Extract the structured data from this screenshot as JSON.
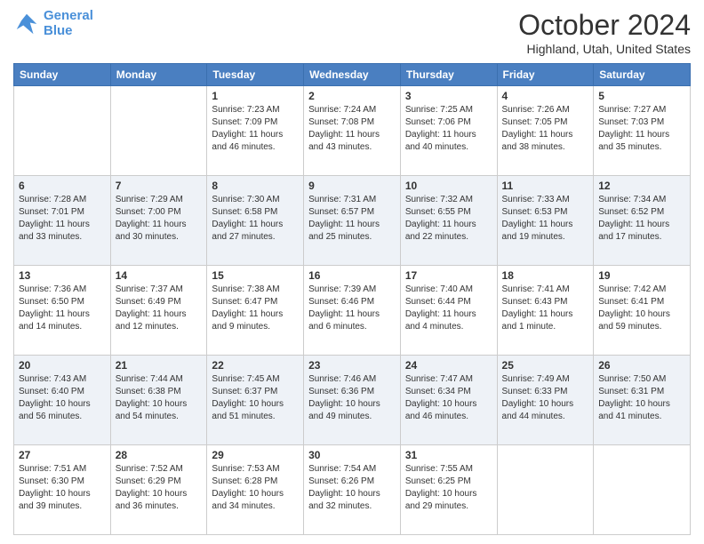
{
  "logo": {
    "line1": "General",
    "line2": "Blue"
  },
  "title": "October 2024",
  "location": "Highland, Utah, United States",
  "days_of_week": [
    "Sunday",
    "Monday",
    "Tuesday",
    "Wednesday",
    "Thursday",
    "Friday",
    "Saturday"
  ],
  "weeks": [
    [
      {
        "day": "",
        "sunrise": "",
        "sunset": "",
        "daylight": ""
      },
      {
        "day": "",
        "sunrise": "",
        "sunset": "",
        "daylight": ""
      },
      {
        "day": "1",
        "sunrise": "Sunrise: 7:23 AM",
        "sunset": "Sunset: 7:09 PM",
        "daylight": "Daylight: 11 hours and 46 minutes."
      },
      {
        "day": "2",
        "sunrise": "Sunrise: 7:24 AM",
        "sunset": "Sunset: 7:08 PM",
        "daylight": "Daylight: 11 hours and 43 minutes."
      },
      {
        "day": "3",
        "sunrise": "Sunrise: 7:25 AM",
        "sunset": "Sunset: 7:06 PM",
        "daylight": "Daylight: 11 hours and 40 minutes."
      },
      {
        "day": "4",
        "sunrise": "Sunrise: 7:26 AM",
        "sunset": "Sunset: 7:05 PM",
        "daylight": "Daylight: 11 hours and 38 minutes."
      },
      {
        "day": "5",
        "sunrise": "Sunrise: 7:27 AM",
        "sunset": "Sunset: 7:03 PM",
        "daylight": "Daylight: 11 hours and 35 minutes."
      }
    ],
    [
      {
        "day": "6",
        "sunrise": "Sunrise: 7:28 AM",
        "sunset": "Sunset: 7:01 PM",
        "daylight": "Daylight: 11 hours and 33 minutes."
      },
      {
        "day": "7",
        "sunrise": "Sunrise: 7:29 AM",
        "sunset": "Sunset: 7:00 PM",
        "daylight": "Daylight: 11 hours and 30 minutes."
      },
      {
        "day": "8",
        "sunrise": "Sunrise: 7:30 AM",
        "sunset": "Sunset: 6:58 PM",
        "daylight": "Daylight: 11 hours and 27 minutes."
      },
      {
        "day": "9",
        "sunrise": "Sunrise: 7:31 AM",
        "sunset": "Sunset: 6:57 PM",
        "daylight": "Daylight: 11 hours and 25 minutes."
      },
      {
        "day": "10",
        "sunrise": "Sunrise: 7:32 AM",
        "sunset": "Sunset: 6:55 PM",
        "daylight": "Daylight: 11 hours and 22 minutes."
      },
      {
        "day": "11",
        "sunrise": "Sunrise: 7:33 AM",
        "sunset": "Sunset: 6:53 PM",
        "daylight": "Daylight: 11 hours and 19 minutes."
      },
      {
        "day": "12",
        "sunrise": "Sunrise: 7:34 AM",
        "sunset": "Sunset: 6:52 PM",
        "daylight": "Daylight: 11 hours and 17 minutes."
      }
    ],
    [
      {
        "day": "13",
        "sunrise": "Sunrise: 7:36 AM",
        "sunset": "Sunset: 6:50 PM",
        "daylight": "Daylight: 11 hours and 14 minutes."
      },
      {
        "day": "14",
        "sunrise": "Sunrise: 7:37 AM",
        "sunset": "Sunset: 6:49 PM",
        "daylight": "Daylight: 11 hours and 12 minutes."
      },
      {
        "day": "15",
        "sunrise": "Sunrise: 7:38 AM",
        "sunset": "Sunset: 6:47 PM",
        "daylight": "Daylight: 11 hours and 9 minutes."
      },
      {
        "day": "16",
        "sunrise": "Sunrise: 7:39 AM",
        "sunset": "Sunset: 6:46 PM",
        "daylight": "Daylight: 11 hours and 6 minutes."
      },
      {
        "day": "17",
        "sunrise": "Sunrise: 7:40 AM",
        "sunset": "Sunset: 6:44 PM",
        "daylight": "Daylight: 11 hours and 4 minutes."
      },
      {
        "day": "18",
        "sunrise": "Sunrise: 7:41 AM",
        "sunset": "Sunset: 6:43 PM",
        "daylight": "Daylight: 11 hours and 1 minute."
      },
      {
        "day": "19",
        "sunrise": "Sunrise: 7:42 AM",
        "sunset": "Sunset: 6:41 PM",
        "daylight": "Daylight: 10 hours and 59 minutes."
      }
    ],
    [
      {
        "day": "20",
        "sunrise": "Sunrise: 7:43 AM",
        "sunset": "Sunset: 6:40 PM",
        "daylight": "Daylight: 10 hours and 56 minutes."
      },
      {
        "day": "21",
        "sunrise": "Sunrise: 7:44 AM",
        "sunset": "Sunset: 6:38 PM",
        "daylight": "Daylight: 10 hours and 54 minutes."
      },
      {
        "day": "22",
        "sunrise": "Sunrise: 7:45 AM",
        "sunset": "Sunset: 6:37 PM",
        "daylight": "Daylight: 10 hours and 51 minutes."
      },
      {
        "day": "23",
        "sunrise": "Sunrise: 7:46 AM",
        "sunset": "Sunset: 6:36 PM",
        "daylight": "Daylight: 10 hours and 49 minutes."
      },
      {
        "day": "24",
        "sunrise": "Sunrise: 7:47 AM",
        "sunset": "Sunset: 6:34 PM",
        "daylight": "Daylight: 10 hours and 46 minutes."
      },
      {
        "day": "25",
        "sunrise": "Sunrise: 7:49 AM",
        "sunset": "Sunset: 6:33 PM",
        "daylight": "Daylight: 10 hours and 44 minutes."
      },
      {
        "day": "26",
        "sunrise": "Sunrise: 7:50 AM",
        "sunset": "Sunset: 6:31 PM",
        "daylight": "Daylight: 10 hours and 41 minutes."
      }
    ],
    [
      {
        "day": "27",
        "sunrise": "Sunrise: 7:51 AM",
        "sunset": "Sunset: 6:30 PM",
        "daylight": "Daylight: 10 hours and 39 minutes."
      },
      {
        "day": "28",
        "sunrise": "Sunrise: 7:52 AM",
        "sunset": "Sunset: 6:29 PM",
        "daylight": "Daylight: 10 hours and 36 minutes."
      },
      {
        "day": "29",
        "sunrise": "Sunrise: 7:53 AM",
        "sunset": "Sunset: 6:28 PM",
        "daylight": "Daylight: 10 hours and 34 minutes."
      },
      {
        "day": "30",
        "sunrise": "Sunrise: 7:54 AM",
        "sunset": "Sunset: 6:26 PM",
        "daylight": "Daylight: 10 hours and 32 minutes."
      },
      {
        "day": "31",
        "sunrise": "Sunrise: 7:55 AM",
        "sunset": "Sunset: 6:25 PM",
        "daylight": "Daylight: 10 hours and 29 minutes."
      },
      {
        "day": "",
        "sunrise": "",
        "sunset": "",
        "daylight": ""
      },
      {
        "day": "",
        "sunrise": "",
        "sunset": "",
        "daylight": ""
      }
    ]
  ]
}
